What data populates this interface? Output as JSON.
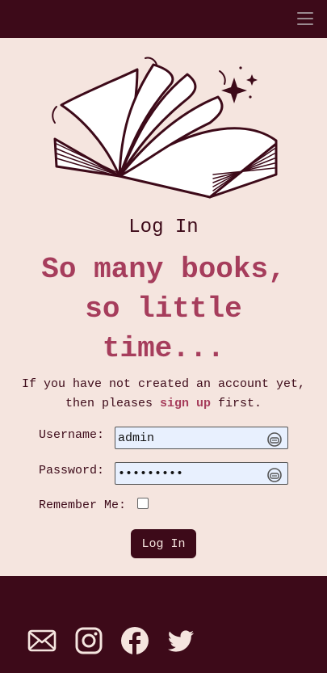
{
  "navbar": {
    "menu_icon": "hamburger-menu-icon"
  },
  "hero": {
    "illustration": "open-book-illustration"
  },
  "login": {
    "title": "Log In",
    "tagline": "So many books, so little time...",
    "intro_before": "If you have not created an account yet, then pleases ",
    "intro_link": "sign up",
    "intro_after": " first.",
    "username_label": "Username:",
    "username_value": "admin",
    "password_label": "Password:",
    "password_value": "abcdefghi",
    "remember_label": "Remember Me:",
    "remember_checked": false,
    "submit_label": "Log In"
  },
  "colors": {
    "brand_dark": "#3d0a19",
    "accent": "#a63d5c",
    "background": "#f5e5df"
  },
  "footer": {
    "social": [
      "mail-icon",
      "instagram-icon",
      "facebook-icon",
      "twitter-icon"
    ]
  }
}
